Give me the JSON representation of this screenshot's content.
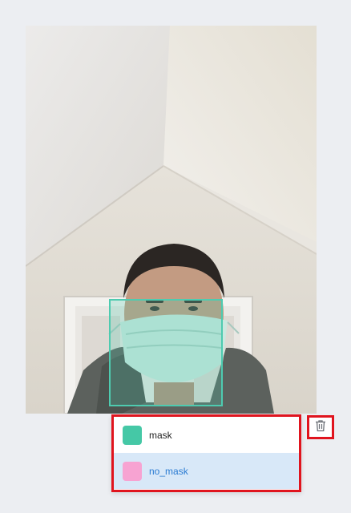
{
  "image": {
    "description_icon": "photo-of-person-wearing-mask"
  },
  "annotation": {
    "box_color": "#4ecbb0",
    "selected_class": "no_mask"
  },
  "class_menu": {
    "items": [
      {
        "label": "mask",
        "color": "#45c8a6",
        "selected": false
      },
      {
        "label": "no_mask",
        "color": "#f7a3d2",
        "selected": true
      }
    ]
  },
  "toolbar": {
    "delete_icon": "trash-icon"
  },
  "colors": {
    "highlight_border": "#e0141e",
    "selected_text": "#2a7bd2",
    "selected_bg": "#d8e8f8"
  }
}
